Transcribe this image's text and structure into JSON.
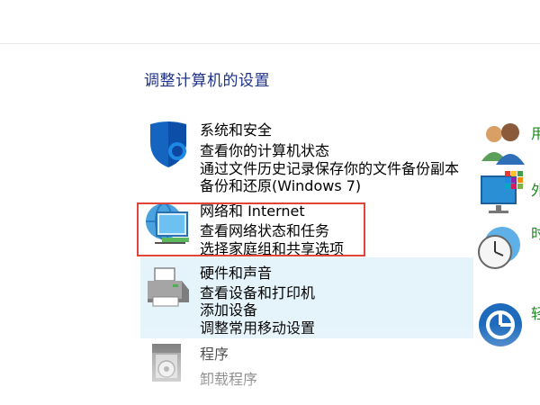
{
  "page": {
    "title": "调整计算机的设置"
  },
  "categories": [
    {
      "title": "系统和安全",
      "icon": "shield-icon",
      "links": [
        "查看你的计算机状态",
        "通过文件历史记录保存你的文件备份副本",
        "备份和还原(Windows 7)"
      ]
    },
    {
      "title": "网络和 Internet",
      "icon": "network-globe-icon",
      "links": [
        "查看网络状态和任务",
        "选择家庭组和共享选项"
      ]
    },
    {
      "title": "硬件和声音",
      "icon": "printer-icon",
      "links": [
        "查看设备和打印机",
        "添加设备",
        "调整常用移动设置"
      ]
    },
    {
      "title": "程序",
      "icon": "programs-icon",
      "links": [
        "卸载程序"
      ]
    }
  ],
  "right_column": {
    "stubs": [
      "用",
      "外",
      "时",
      "轻"
    ],
    "icons": [
      "user-accounts-icon",
      "appearance-icon",
      "clock-globe-icon",
      "ease-of-access-icon"
    ]
  },
  "colors": {
    "title_green": "#1f8a1f",
    "link_blue": "#1a3b9c",
    "hover_blue": "#e5f3fb",
    "highlight_red": "#e0443a"
  }
}
